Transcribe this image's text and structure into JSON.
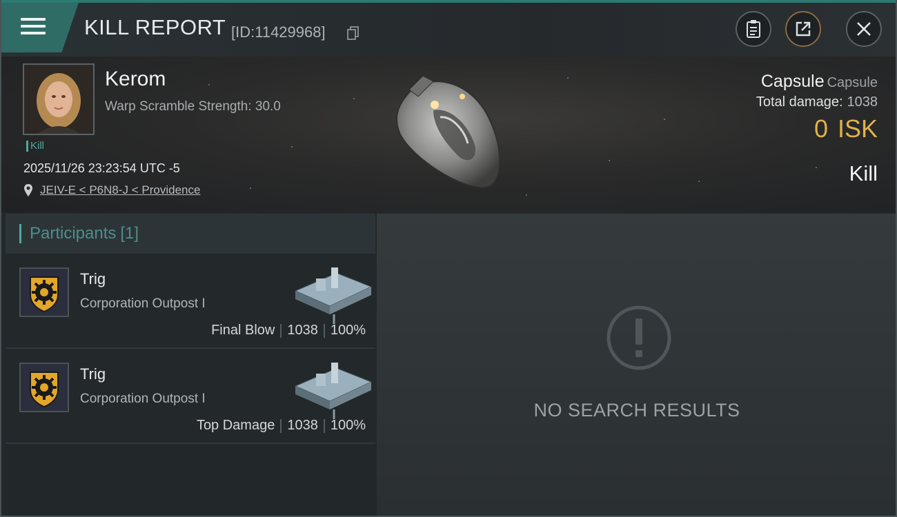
{
  "header": {
    "title": "KILL REPORT",
    "report_id": "[ID:11429968]",
    "icons": [
      "menu-icon",
      "copy-icon",
      "clipboard-icon",
      "share-icon",
      "close-icon"
    ]
  },
  "victim": {
    "name": "Kerom",
    "warp_scramble": "Warp Scramble Strength: 30.0",
    "tag": "Kill",
    "timestamp": "2025/11/26 23:23:54 UTC -5",
    "location": "JEIV-E < P6N8-J < Providence",
    "ship_name": "Capsule",
    "ship_type": "Capsule",
    "total_damage_label": "Total damage:",
    "total_damage_value": "1038",
    "isk_value": "0",
    "isk_unit": "ISK",
    "result": "Kill"
  },
  "participants": {
    "title": "Participants",
    "count": "[1]",
    "items": [
      {
        "name": "Trig",
        "ship": "Corporation Outpost I",
        "role": "Final Blow",
        "damage": "1038",
        "percent": "100%"
      },
      {
        "name": "Trig",
        "ship": "Corporation Outpost I",
        "role": "Top Damage",
        "damage": "1038",
        "percent": "100%"
      }
    ]
  },
  "results": {
    "empty_message": "NO SEARCH RESULTS",
    "icon": "warning-icon"
  },
  "colors": {
    "accent": "#2f6c66",
    "isk": "#e0b249",
    "teal_text": "#4fa9a0"
  }
}
